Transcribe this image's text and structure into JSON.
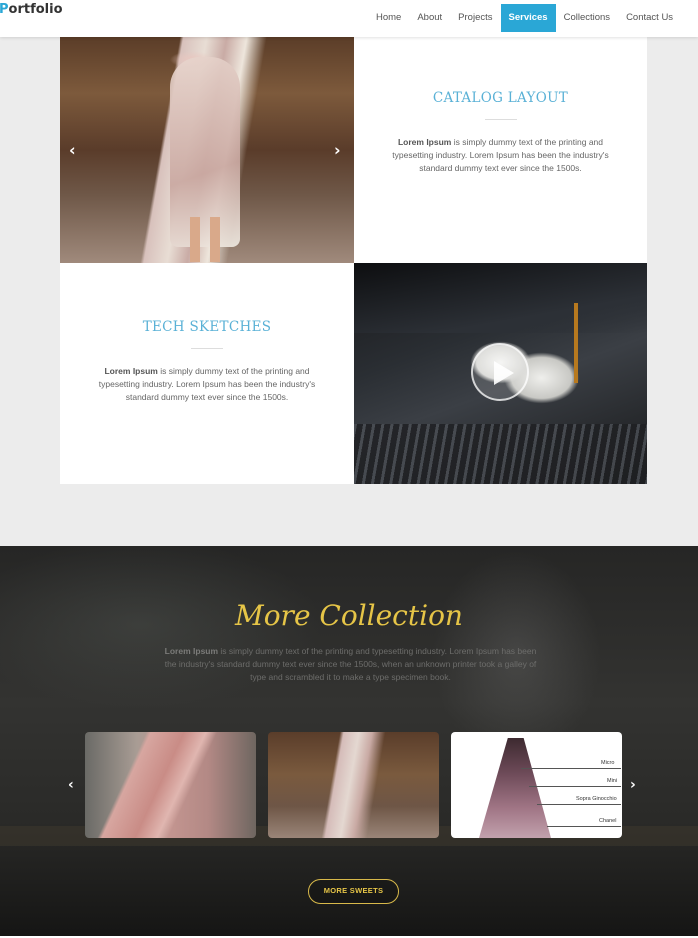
{
  "nav": {
    "brand": "Portfolio",
    "items": [
      {
        "label": "Home",
        "active": false
      },
      {
        "label": "About",
        "active": false
      },
      {
        "label": "Projects",
        "active": false
      },
      {
        "label": "Services",
        "active": true
      },
      {
        "label": "Collections",
        "active": false
      },
      {
        "label": "Contact Us",
        "active": false
      }
    ]
  },
  "catalog": {
    "title": "CATALOG LAYOUT",
    "body_bold": "Lorem Ipsum",
    "body": " is simply dummy text of the printing and typesetting industry. Lorem Ipsum has been the industry's standard dummy text ever since the 1500s."
  },
  "sketches": {
    "title": "TECH SKETCHES",
    "body_bold": "Lorem Ipsum",
    "body": " is simply dummy text of the printing and typesetting industry. Lorem Ipsum has been the industry's standard dummy text ever since the 1500s."
  },
  "carousel": {
    "prev_icon": "‹",
    "next_icon": "›"
  },
  "collection": {
    "title": "More Collection",
    "text_bold": "Lorem Ipsum",
    "text": " is simply dummy text of the printing and typesetting industry. Lorem Ipsum has been the industry's standard dummy text ever since the 1500s, when an unknown printer took a galley of type and scrambled it to make a type specimen book.",
    "button": "MORE SWEETS",
    "sketch_labels": [
      "Micro",
      "Mini",
      "Sopra Ginocchio",
      "Chanel"
    ]
  },
  "colors": {
    "accent": "#2aa7d6",
    "heading": "#5ab1d6",
    "gold": "#e6c547"
  }
}
